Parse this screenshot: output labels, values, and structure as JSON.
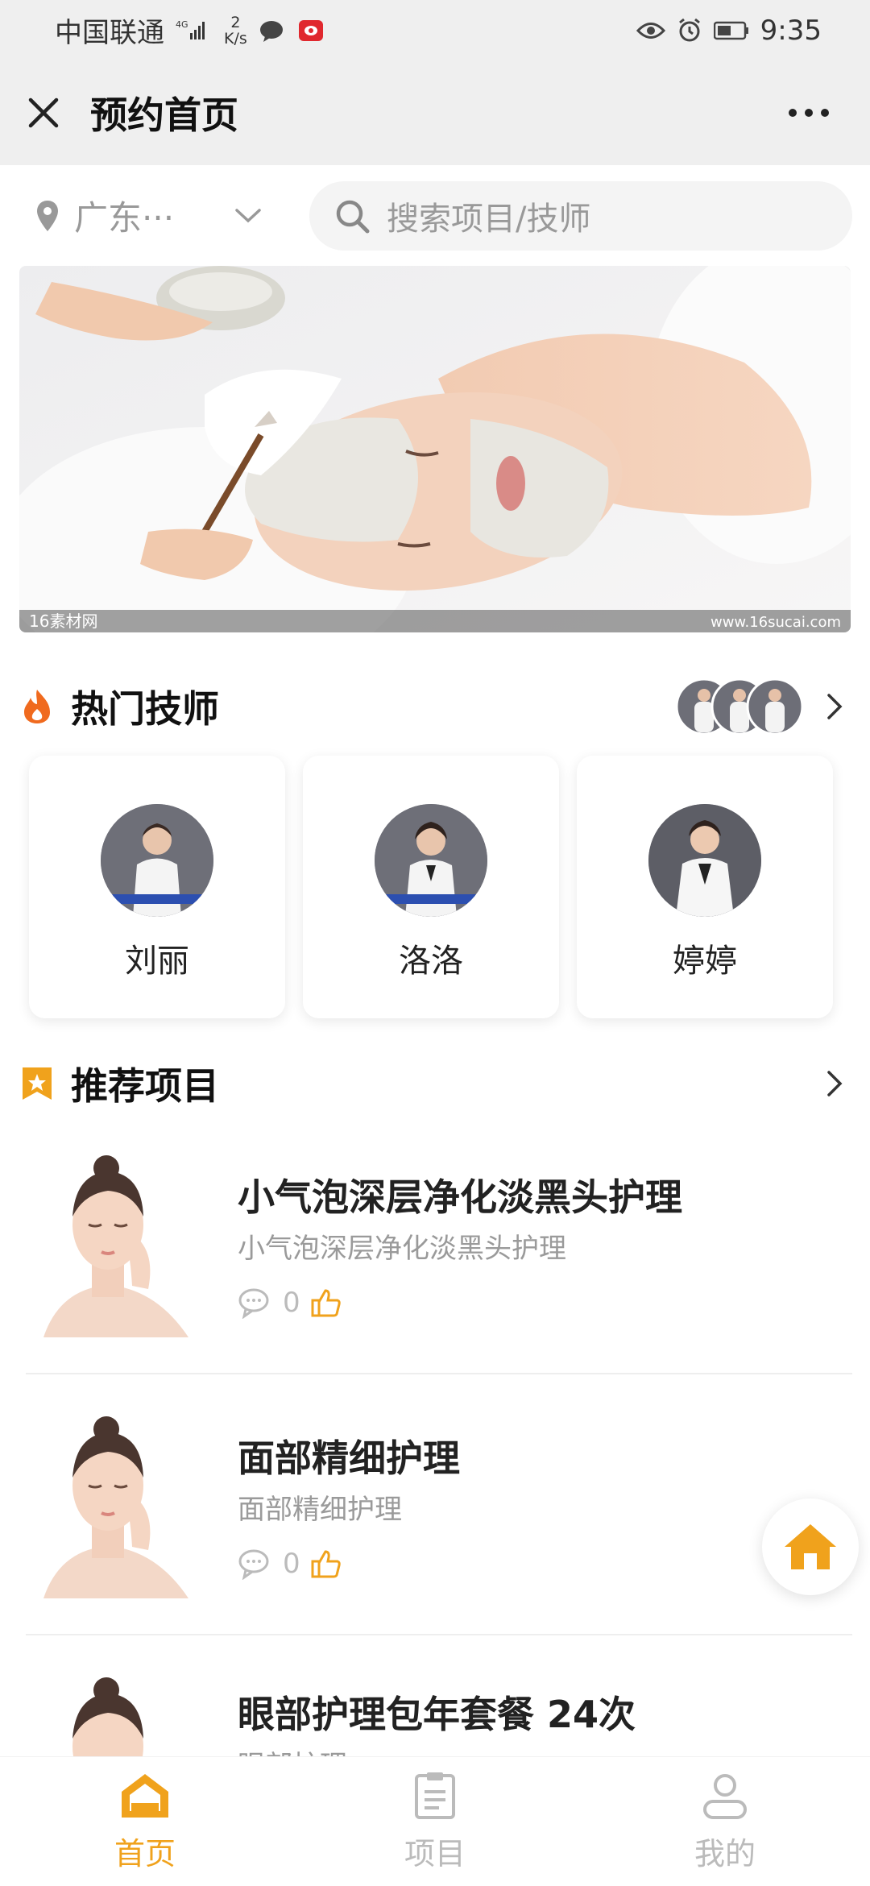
{
  "status_bar": {
    "carrier": "中国联通",
    "network": "4G",
    "speed_value": "2",
    "speed_unit": "K/s",
    "time": "9:35"
  },
  "header": {
    "title": "预约首页"
  },
  "search": {
    "location": "广东···",
    "placeholder": "搜索项目/技师"
  },
  "banner": {
    "watermark_left": "16素材网",
    "watermark_right": "www.16sucai.com"
  },
  "hot_techs": {
    "title": "热门技师",
    "items": [
      {
        "name": "刘丽"
      },
      {
        "name": "洛洛"
      },
      {
        "name": "婷婷"
      }
    ]
  },
  "recommend": {
    "title": "推荐项目",
    "items": [
      {
        "title": "小气泡深层净化淡黑头护理",
        "subtitle": "小气泡深层净化淡黑头护理",
        "comments": "0"
      },
      {
        "title": "面部精细护理",
        "subtitle": "面部精细护理",
        "comments": "0"
      },
      {
        "title": "眼部护理包年套餐 24次",
        "subtitle": "眼部护理"
      }
    ]
  },
  "tabs": [
    {
      "label": "首页"
    },
    {
      "label": "项目"
    },
    {
      "label": "我的"
    }
  ],
  "colors": {
    "accent": "#f0a21c",
    "fire": "#f06a1e",
    "bg": "#efefef"
  }
}
